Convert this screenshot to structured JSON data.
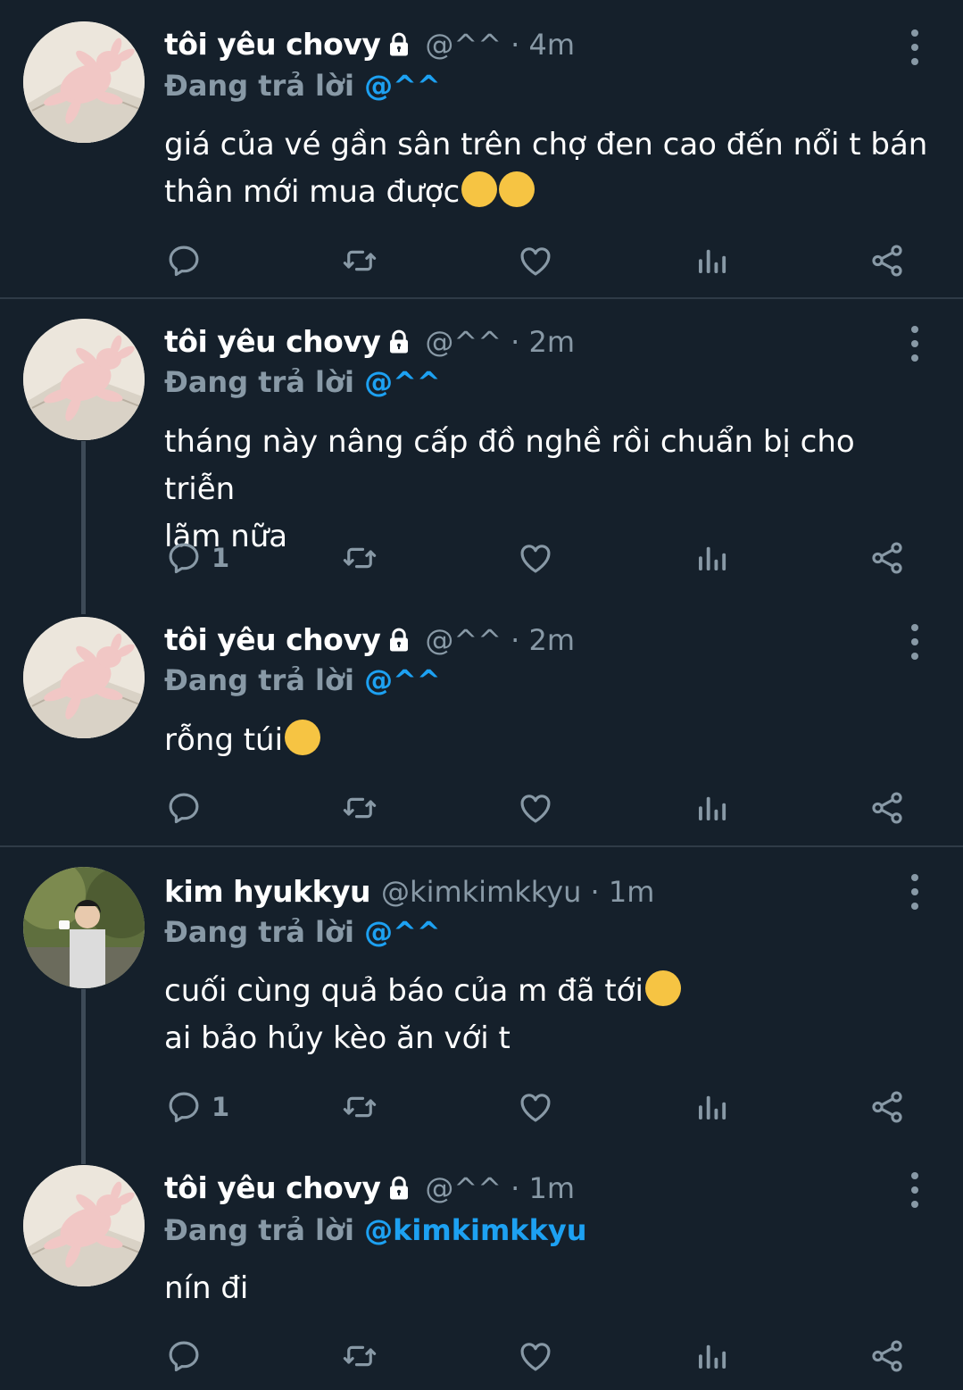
{
  "tweets": [
    {
      "name": "tôi yêu chovy",
      "handle": "@^^ · 4m",
      "replying_prefix": "Đang trả lời ",
      "replying_to": "@^^",
      "text": "giá của vé gần sân trên chợ đen cao đến nổi t bán\nthân mới mua được",
      "emoji": [
        "crying-face",
        "crying-face"
      ],
      "reply_count": ""
    },
    {
      "name": "tôi yêu chovy",
      "handle": "@^^ · 2m",
      "replying_prefix": "Đang trả lời ",
      "replying_to": "@^^",
      "text": "tháng này nâng cấp đồ nghề rồi chuẩn bị cho triễn\nlãm nữa",
      "emoji": [],
      "reply_count": "1"
    },
    {
      "name": "tôi yêu chovy",
      "handle": "@^^ · 2m",
      "replying_prefix": "Đang trả lời ",
      "replying_to": "@^^",
      "text": "rỗng túi",
      "emoji": [
        "smiling-face-with-hearts"
      ],
      "reply_count": ""
    },
    {
      "name": "kim hyukkyu",
      "handle": "@kimkimkkyu · 1m",
      "replying_prefix": "Đang trả lời ",
      "replying_to": "@^^",
      "text_line1": "cuối cùng quả báo của m đã tới",
      "text_line2": "ai bảo hủy kèo ăn với t",
      "emoji": [
        "smirking-face"
      ],
      "reply_count": "1"
    },
    {
      "name": "tôi yêu chovy",
      "handle": "@^^ · 1m",
      "replying_prefix": "Đang trả lời ",
      "replying_to": "@kimkimkkyu",
      "text": "nín đi",
      "emoji": [],
      "reply_count": ""
    }
  ],
  "colors": {
    "background": "#15202b",
    "secondary_text": "#8899a6",
    "mention": "#1da1f2",
    "divider": "#2f3b47"
  }
}
